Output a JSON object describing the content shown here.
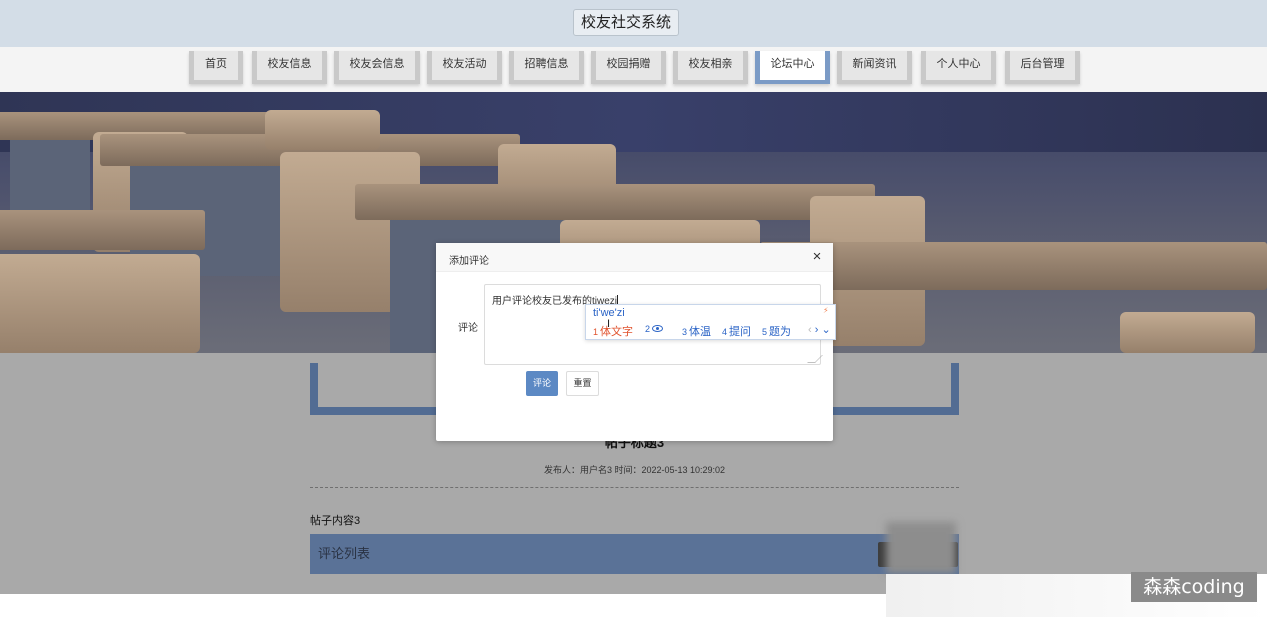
{
  "header": {
    "title": "校友社交系统"
  },
  "nav": {
    "items": [
      {
        "label": "首页"
      },
      {
        "label": "校友信息"
      },
      {
        "label": "校友会信息"
      },
      {
        "label": "校友活动"
      },
      {
        "label": "招聘信息"
      },
      {
        "label": "校园捐赠"
      },
      {
        "label": "校友相亲"
      },
      {
        "label": "论坛中心",
        "active": true
      },
      {
        "label": "新闻资讯"
      },
      {
        "label": "个人中心"
      },
      {
        "label": "后台管理"
      }
    ]
  },
  "post": {
    "title": "帖子标题3",
    "meta": "发布人：用户名3 时间：2022-05-13 10:29:02",
    "content": "帖子内容3",
    "comment_list_label": "评论列表"
  },
  "dialog": {
    "title": "添加评论",
    "close_glyph": "×",
    "field_label": "评论",
    "textarea_text": "用户评论校友已发布的",
    "textarea_ime_text": "tiwezi",
    "submit_label": "评论",
    "reset_label": "重置"
  },
  "ime": {
    "input": "ti'we'zi",
    "candidates": [
      {
        "num": "1",
        "text": "体文字"
      },
      {
        "num": "2",
        "text": ""
      },
      {
        "num": "3",
        "text": "体温"
      },
      {
        "num": "4",
        "text": "提问"
      },
      {
        "num": "5",
        "text": "题为"
      }
    ],
    "prev_glyph": "‹",
    "next_glyph": "›",
    "more_glyph": "⌄"
  },
  "watermark": {
    "text": "森森coding"
  },
  "colors": {
    "header_bg": "#d3dde7",
    "nav_active_border": "#7b9bc6",
    "accent_blue": "#5c89c4",
    "comment_bar": "#5a7297",
    "overlay_gray": "#a9a9a9"
  }
}
